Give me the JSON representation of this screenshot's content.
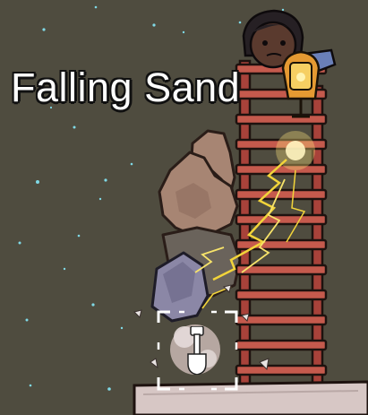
{
  "caption": "Falling Sand",
  "tool": {
    "name": "dig-tool",
    "icon": "shovel-icon"
  },
  "colors": {
    "background": "#4f4c3f",
    "ladder_rail": "#a8423a",
    "ladder_rung": "#c55a4d",
    "sand": "#a78573",
    "electricity": "#f2d43a",
    "caption_text": "#ffffff"
  }
}
